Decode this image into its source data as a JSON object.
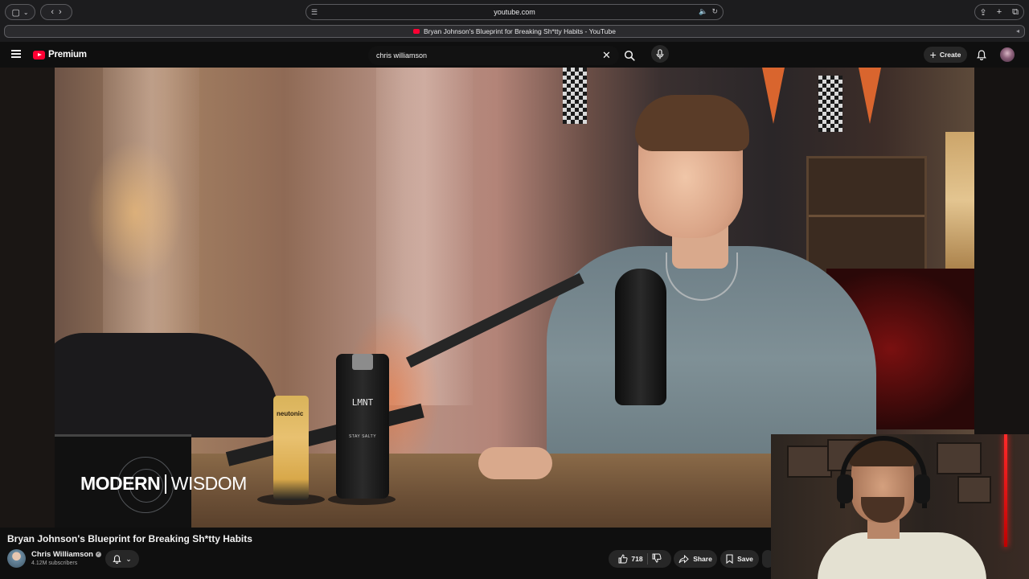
{
  "browser": {
    "url": "youtube.com",
    "tab_title": "Bryan Johnson's Blueprint for Breaking Sh*tty Habits - YouTube"
  },
  "masthead": {
    "logo_text": "Premium",
    "search_query": "chris williamson",
    "create_label": "Create",
    "brand_color": "#ff0033"
  },
  "video": {
    "watermark_left": "MODERN",
    "watermark_right": "WISDOM",
    "can_label": "neutonic",
    "bottle_text": "LMNT",
    "bottle_subtext": "STAY SALTY"
  },
  "details": {
    "title": "Bryan Johnson's Blueprint for Breaking Sh*tty Habits",
    "channel_name": "Chris Williamson",
    "subscribers": "4.12M subscribers",
    "like_count": "718",
    "share_label": "Share",
    "save_label": "Save"
  }
}
